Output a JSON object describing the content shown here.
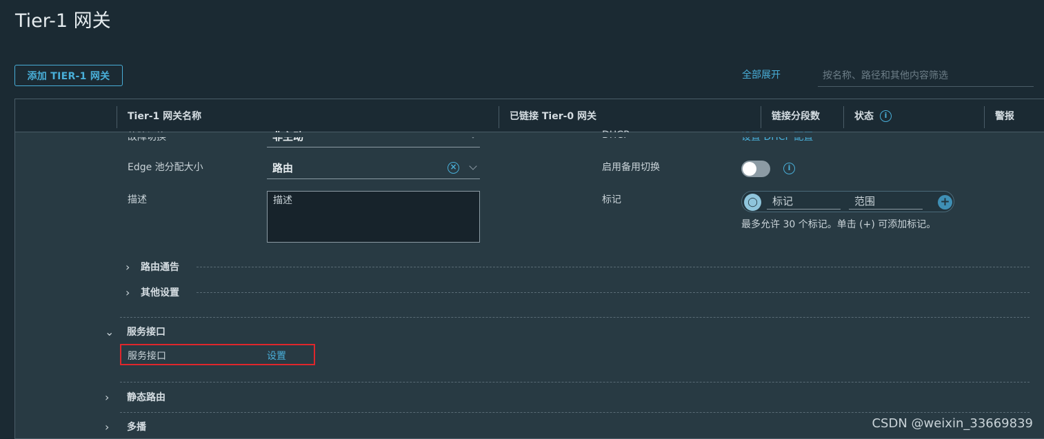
{
  "page": {
    "title": "Tier-1 网关"
  },
  "toolbar": {
    "add_label": "添加 TIER-1 网关",
    "expand_all": "全部展开",
    "filter_placeholder": "按名称、路径和其他内容筛选"
  },
  "table": {
    "columns": [
      "Tier-1 网关名称",
      "已链接 Tier-0 网关",
      "链接分段数",
      "状态",
      "警报"
    ]
  },
  "form": {
    "failover_label": "故障切换",
    "failover_value": "非主动",
    "edge_pool_label": "Edge 池分配大小",
    "edge_pool_value": "路由",
    "description_label": "描述",
    "description_placeholder": "描述",
    "dhcp_label": "DHCP",
    "dhcp_link": "设置 DHCP 配置",
    "standby_label": "启用备用切换",
    "standby_enabled": false,
    "tags_label": "标记",
    "tag_placeholder": "标记",
    "scope_placeholder": "范围",
    "tags_hint": "最多允许 30 个标记。单击 (+) 可添加标记。"
  },
  "sections": {
    "route_advertisement": "路由通告",
    "other_settings": "其他设置"
  },
  "groups": {
    "service_interface": {
      "title": "服务接口",
      "row_label": "服务接口",
      "row_link": "设置"
    },
    "static_routes": "静态路由",
    "multicast": "多播"
  },
  "icons": {
    "clear": "clear-icon",
    "chevron": "chevron-down-icon",
    "info": "info-icon",
    "tag": "tag-icon",
    "add": "plus-icon"
  },
  "colors": {
    "background": "#1b2a33",
    "panel": "#283a43",
    "accent": "#49afd9",
    "highlight_border": "#e0262b"
  },
  "watermark": "CSDN @weixin_33669839"
}
